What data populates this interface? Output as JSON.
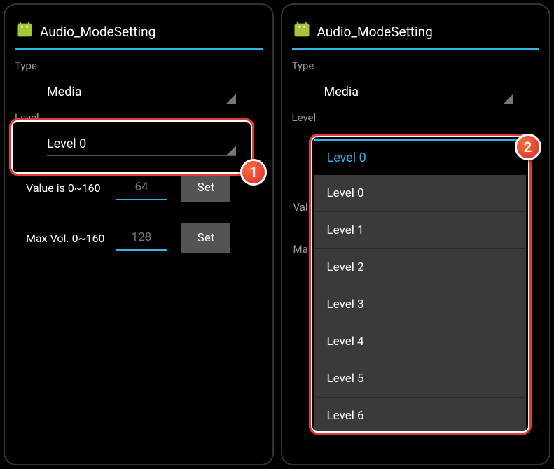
{
  "left": {
    "title": "Audio_ModeSetting",
    "type_label": "Type",
    "type_value": "Media",
    "level_label": "Level",
    "level_value": "Level 0",
    "value_label": "Value is 0~160",
    "value_input": "64",
    "max_label": "Max Vol. 0~160",
    "max_input": "128",
    "set_button": "Set",
    "badge": "1"
  },
  "right": {
    "title": "Audio_ModeSetting",
    "type_label": "Type",
    "type_value": "Media",
    "level_label": "Level",
    "val_partial": "Val",
    "max_partial": "Ma",
    "dropdown_header": "Level 0",
    "dropdown_items": [
      "Level 0",
      "Level 1",
      "Level 2",
      "Level 3",
      "Level 4",
      "Level 5",
      "Level 6"
    ],
    "badge": "2"
  }
}
